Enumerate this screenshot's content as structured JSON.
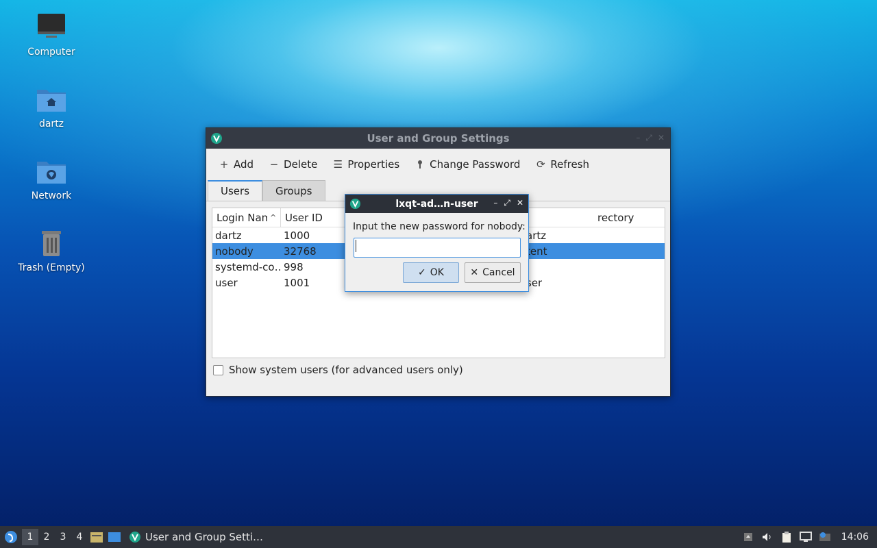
{
  "desktop": {
    "icons": [
      {
        "label": "Computer"
      },
      {
        "label": "dartz"
      },
      {
        "label": "Network"
      },
      {
        "label": "Trash (Empty)"
      }
    ]
  },
  "main_window": {
    "title": "User and Group Settings",
    "toolbar": {
      "add": "Add",
      "delete": "Delete",
      "properties": "Properties",
      "change_password": "Change Password",
      "refresh": "Refresh"
    },
    "tabs": [
      {
        "label": "Users",
        "active": true
      },
      {
        "label": "Groups",
        "active": false
      }
    ],
    "table": {
      "columns": [
        "Login Name",
        "User ID",
        "rectory"
      ],
      "rows": [
        {
          "login": "dartz",
          "uid": "1000",
          "home": "artz",
          "selected": false
        },
        {
          "login": "nobody",
          "uid": "32768",
          "home": "tent",
          "selected": true
        },
        {
          "login": "systemd-co…",
          "uid": "998",
          "home": "",
          "selected": false
        },
        {
          "login": "user",
          "uid": "1001",
          "home": "ser",
          "selected": false
        }
      ]
    },
    "show_system_users": "Show system users (for advanced users only)"
  },
  "dialog": {
    "title": "lxqt-ad…n-user",
    "label": "Input the new password for nobody:",
    "input_value": "",
    "ok": "OK",
    "cancel": "Cancel"
  },
  "taskbar": {
    "workspaces": [
      "1",
      "2",
      "3",
      "4"
    ],
    "active_workspace": "1",
    "task_label": "User and Group Setti…",
    "clock": "14:06"
  },
  "colors": {
    "accent": "#3d8ee0",
    "titlebar": "#353a44",
    "taskbar": "#2e323a"
  }
}
